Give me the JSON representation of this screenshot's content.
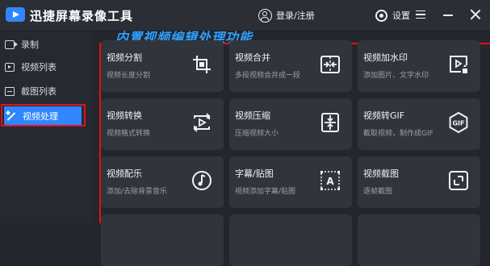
{
  "app": {
    "title": "迅捷屏幕录像工具",
    "login_label": "登录/注册",
    "settings_label": "设置"
  },
  "sidebar": {
    "items": [
      {
        "label": "录制",
        "icon": "record-icon"
      },
      {
        "label": "视频列表",
        "icon": "video-list-icon"
      },
      {
        "label": "截图列表",
        "icon": "screenshot-list-icon"
      },
      {
        "label": "视频处理",
        "icon": "magic-wand-icon",
        "active": true
      }
    ]
  },
  "main": {
    "banner": "内置视频编辑处理功能",
    "cards": [
      {
        "title": "视频分割",
        "desc": "视频长度分割",
        "icon": "crop-icon"
      },
      {
        "title": "视频合并",
        "desc": "多段视频合并成一段",
        "icon": "merge-icon"
      },
      {
        "title": "视频加水印",
        "desc": "添加图片、文字水印",
        "icon": "watermark-icon"
      },
      {
        "title": "视频转换",
        "desc": "视频格式转换",
        "icon": "convert-icon"
      },
      {
        "title": "视频压缩",
        "desc": "压缩视频大小",
        "icon": "compress-icon"
      },
      {
        "title": "视频转GIF",
        "desc": "截取视频，制作成GIF",
        "icon": "gif-icon"
      },
      {
        "title": "视频配乐",
        "desc": "添加/去除背景音乐",
        "icon": "music-icon"
      },
      {
        "title": "字幕/贴图",
        "desc": "视频添加字幕/贴图",
        "icon": "subtitle-icon"
      },
      {
        "title": "视频截图",
        "desc": "逐帧截图",
        "icon": "screenshot-icon"
      }
    ]
  },
  "colors": {
    "accent": "#2f86ff",
    "highlight": "#e1121a",
    "banner": "#2fa0ff",
    "background": "#23262d",
    "card": "#31343b"
  }
}
